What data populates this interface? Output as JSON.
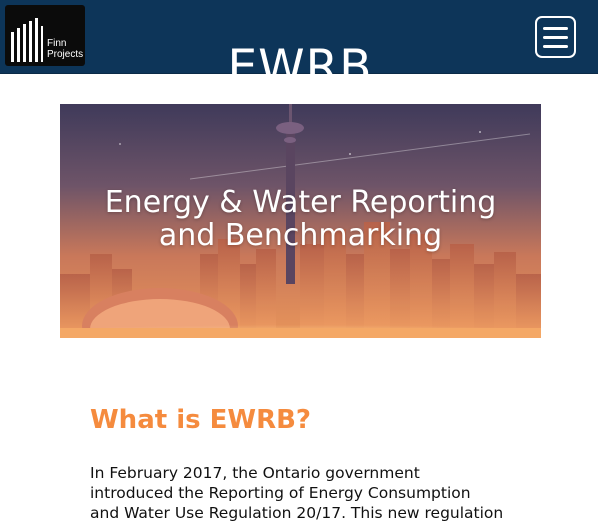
{
  "header": {
    "logo": {
      "line1": "Finn",
      "line2": "Projects"
    },
    "title": "EWRB",
    "menu_icon": "hamburger-menu-icon",
    "background_color": "#0d3559"
  },
  "hero": {
    "title_line1": "Energy & Water Reporting",
    "title_line2": "and Benchmarking",
    "image": "toronto-skyline-at-dusk"
  },
  "content": {
    "heading": "What is EWRB?",
    "heading_color": "#f58b3e",
    "paragraph_lines": [
      "In February 2017, the Ontario government",
      "introduced the Reporting of Energy Consumption",
      "and Water Use Regulation 20/17. This new regulation"
    ]
  }
}
